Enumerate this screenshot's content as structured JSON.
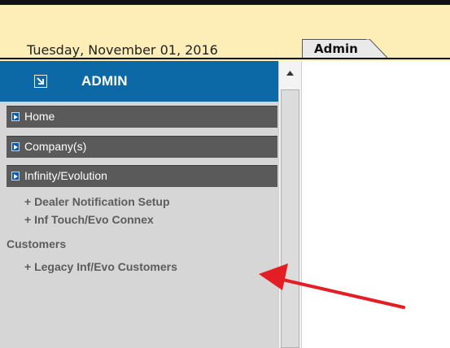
{
  "header": {
    "date": "Tuesday, November 01, 2016",
    "tab_label": "Admin"
  },
  "sidebar": {
    "title": "ADMIN",
    "menu": [
      {
        "label": "Home"
      },
      {
        "label": "Company(s)"
      },
      {
        "label": "Infinity/Evolution"
      }
    ],
    "subitems": [
      "+ Dealer Notification Setup",
      "+ Inf Touch/Evo Connex",
      "Customers",
      "+ Legacy Inf/Evo Customers"
    ]
  },
  "icons": {
    "admin": "collapse-arrow-icon",
    "menu_bullet": "play-bullet-icon",
    "scroll_up": "scroll-up-arrow-icon",
    "annotation": "red-arrow-annotation"
  },
  "colors": {
    "header_band": "#fdeeb8",
    "admin_header": "#0c69a6",
    "menu_bar": "#5a5a5a",
    "sidebar_bg": "#d6d6d6",
    "annotation_arrow": "#e31e24"
  }
}
